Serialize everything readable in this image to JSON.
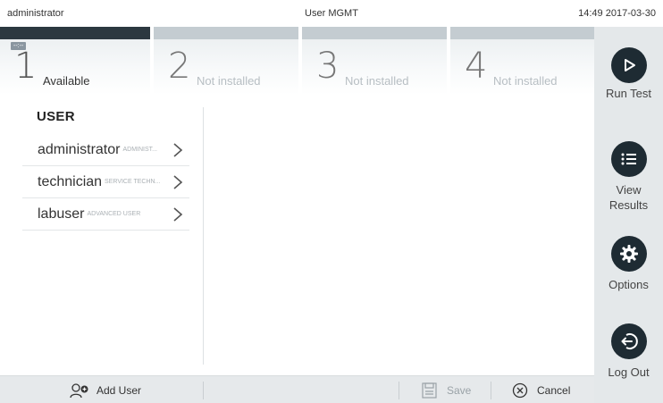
{
  "status": {
    "user": "administrator",
    "title": "User MGMT",
    "datetime": "14:49 2017-03-30"
  },
  "tabs": [
    {
      "num": "1",
      "label": "Available",
      "timer": "--:--",
      "active": true
    },
    {
      "num": "2",
      "label": "Not installed",
      "active": false
    },
    {
      "num": "3",
      "label": "Not installed",
      "active": false
    },
    {
      "num": "4",
      "label": "Not installed",
      "active": false
    }
  ],
  "sidebar": {
    "run_test": "Run Test",
    "view_results_1": "View",
    "view_results_2": "Results",
    "options": "Options",
    "log_out": "Log Out"
  },
  "users": {
    "heading": "USER",
    "items": [
      {
        "name": "administrator",
        "role": "ADMINIST..."
      },
      {
        "name": "technician",
        "role": "SERVICE TECHN..."
      },
      {
        "name": "labuser",
        "role": "ADVANCED USER"
      }
    ]
  },
  "bottom": {
    "add_user": "Add User",
    "save": "Save",
    "cancel": "Cancel"
  },
  "icons": {
    "run": "play-icon",
    "results": "list-icon",
    "options": "gear-icon",
    "logout": "logout-icon",
    "add_user": "add-user-icon",
    "save": "save-icon",
    "cancel": "cancel-icon"
  },
  "colors": {
    "accent_dark": "#1e2b33",
    "sidebar_bg": "#e4e8ea",
    "active_tab_bar": "#2c3840",
    "inactive_tab_bar": "#c4ccd1"
  }
}
